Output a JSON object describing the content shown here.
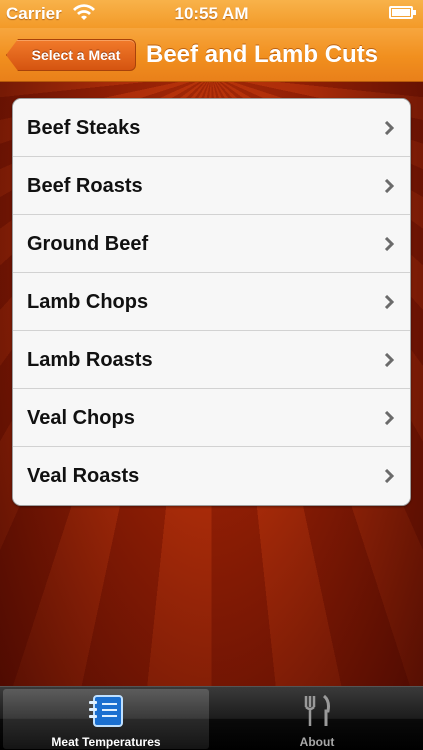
{
  "status_bar": {
    "carrier": "Carrier",
    "time": "10:55 AM",
    "wifi_icon": "wifi-icon",
    "battery_icon": "battery-icon"
  },
  "nav_bar": {
    "back_label": "Select a Meat",
    "title": "Beef and Lamb Cuts"
  },
  "list": {
    "items": [
      {
        "label": "Beef Steaks"
      },
      {
        "label": "Beef Roasts"
      },
      {
        "label": "Ground Beef"
      },
      {
        "label": "Lamb Chops"
      },
      {
        "label": "Lamb Roasts"
      },
      {
        "label": "Veal Chops"
      },
      {
        "label": "Veal Roasts"
      }
    ],
    "chevron_icon": "chevron-right-icon"
  },
  "tab_bar": {
    "tabs": [
      {
        "label": "Meat Temperatures",
        "icon": "notebook-icon",
        "selected": true
      },
      {
        "label": "About",
        "icon": "fork-knife-icon",
        "selected": false
      }
    ]
  },
  "colors": {
    "accent_orange": "#f18f1e",
    "back_button": "#d55410",
    "background_red": "#8a1a06"
  }
}
